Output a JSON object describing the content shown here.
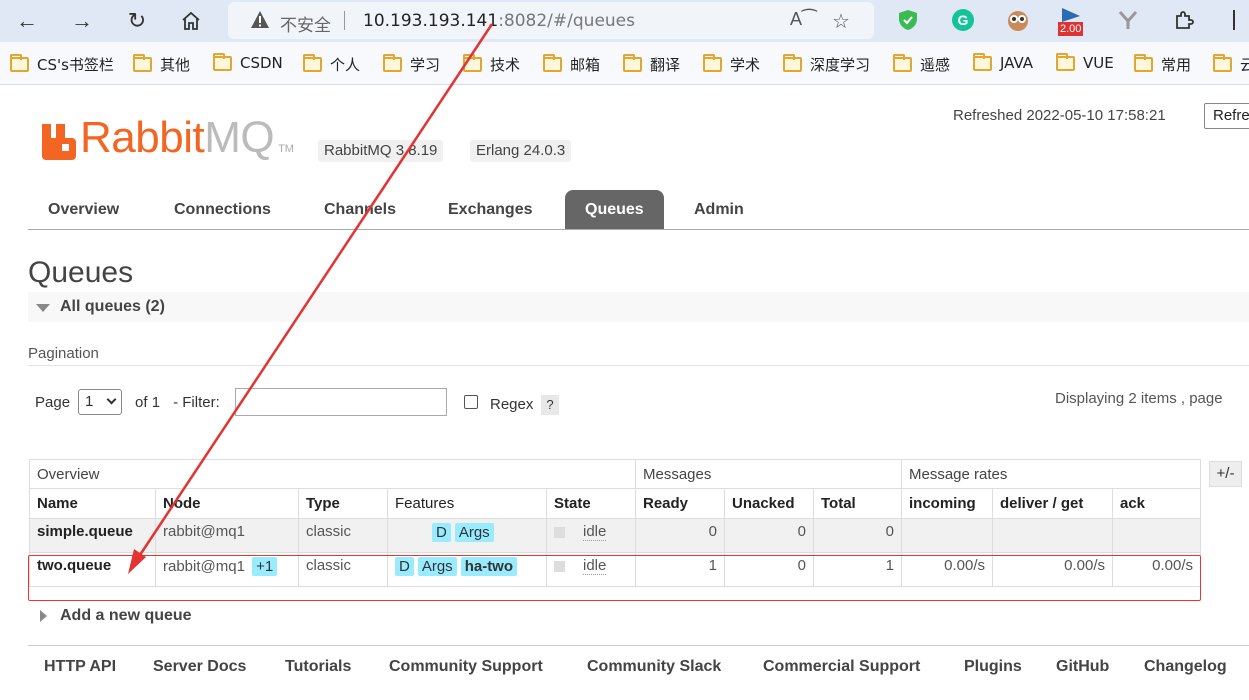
{
  "browser": {
    "insecure_label": "不安全",
    "url_host": "10.193.193.141",
    "url_rest": ":8082/#/queues",
    "ext_badge": "2.00"
  },
  "bookmarks": [
    "CS's书签栏",
    "其他",
    "CSDN",
    "个人",
    "学习",
    "技术",
    "邮箱",
    "翻译",
    "学术",
    "深度学习",
    "遥感",
    "JAVA",
    "VUE",
    "常用",
    "云"
  ],
  "header": {
    "logo_rabbit": "Rabbit",
    "logo_mq": "MQ",
    "logo_tm": "TM",
    "version": "RabbitMQ 3.8.19",
    "erlang": "Erlang 24.0.3",
    "refreshed": "Refreshed 2022-05-10 17:58:21",
    "refresh_button": "Refre"
  },
  "tabs": [
    "Overview",
    "Connections",
    "Channels",
    "Exchanges",
    "Queues",
    "Admin"
  ],
  "page_title": "Queues",
  "all_queues_label": "All queues (2)",
  "pagination": {
    "label": "Pagination",
    "page_label": "Page",
    "page_value": "1",
    "of_label": "of 1",
    "filter_label": "- Filter:",
    "regex_label": "Regex",
    "help": "?",
    "displaying": "Displaying 2 items , page"
  },
  "table": {
    "groups": [
      "Overview",
      "Messages",
      "Message rates"
    ],
    "plus_minus": "+/-",
    "columns": [
      "Name",
      "Node",
      "Type",
      "Features",
      "State",
      "Ready",
      "Unacked",
      "Total",
      "incoming",
      "deliver / get",
      "ack"
    ],
    "rows": [
      {
        "name": "simple.queue",
        "node": "rabbit@mq1",
        "node_extra": "",
        "type": "classic",
        "features": [
          "D",
          "Args"
        ],
        "policy": "",
        "state": "idle",
        "ready": "0",
        "unacked": "0",
        "total": "0",
        "incoming": "",
        "deliver": "",
        "ack": ""
      },
      {
        "name": "two.queue",
        "node": "rabbit@mq1",
        "node_extra": "+1",
        "type": "classic",
        "features": [
          "D",
          "Args"
        ],
        "policy": "ha-two",
        "state": "idle",
        "ready": "1",
        "unacked": "0",
        "total": "1",
        "incoming": "0.00/s",
        "deliver": "0.00/s",
        "ack": "0.00/s"
      }
    ]
  },
  "add_queue_label": "Add a new queue",
  "footer": [
    "HTTP API",
    "Server Docs",
    "Tutorials",
    "Community Support",
    "Community Slack",
    "Commercial Support",
    "Plugins",
    "GitHub",
    "Changelog"
  ],
  "colors": {
    "brand": "#f26522",
    "badge": "#99ebff",
    "annotation": "#e33333"
  }
}
